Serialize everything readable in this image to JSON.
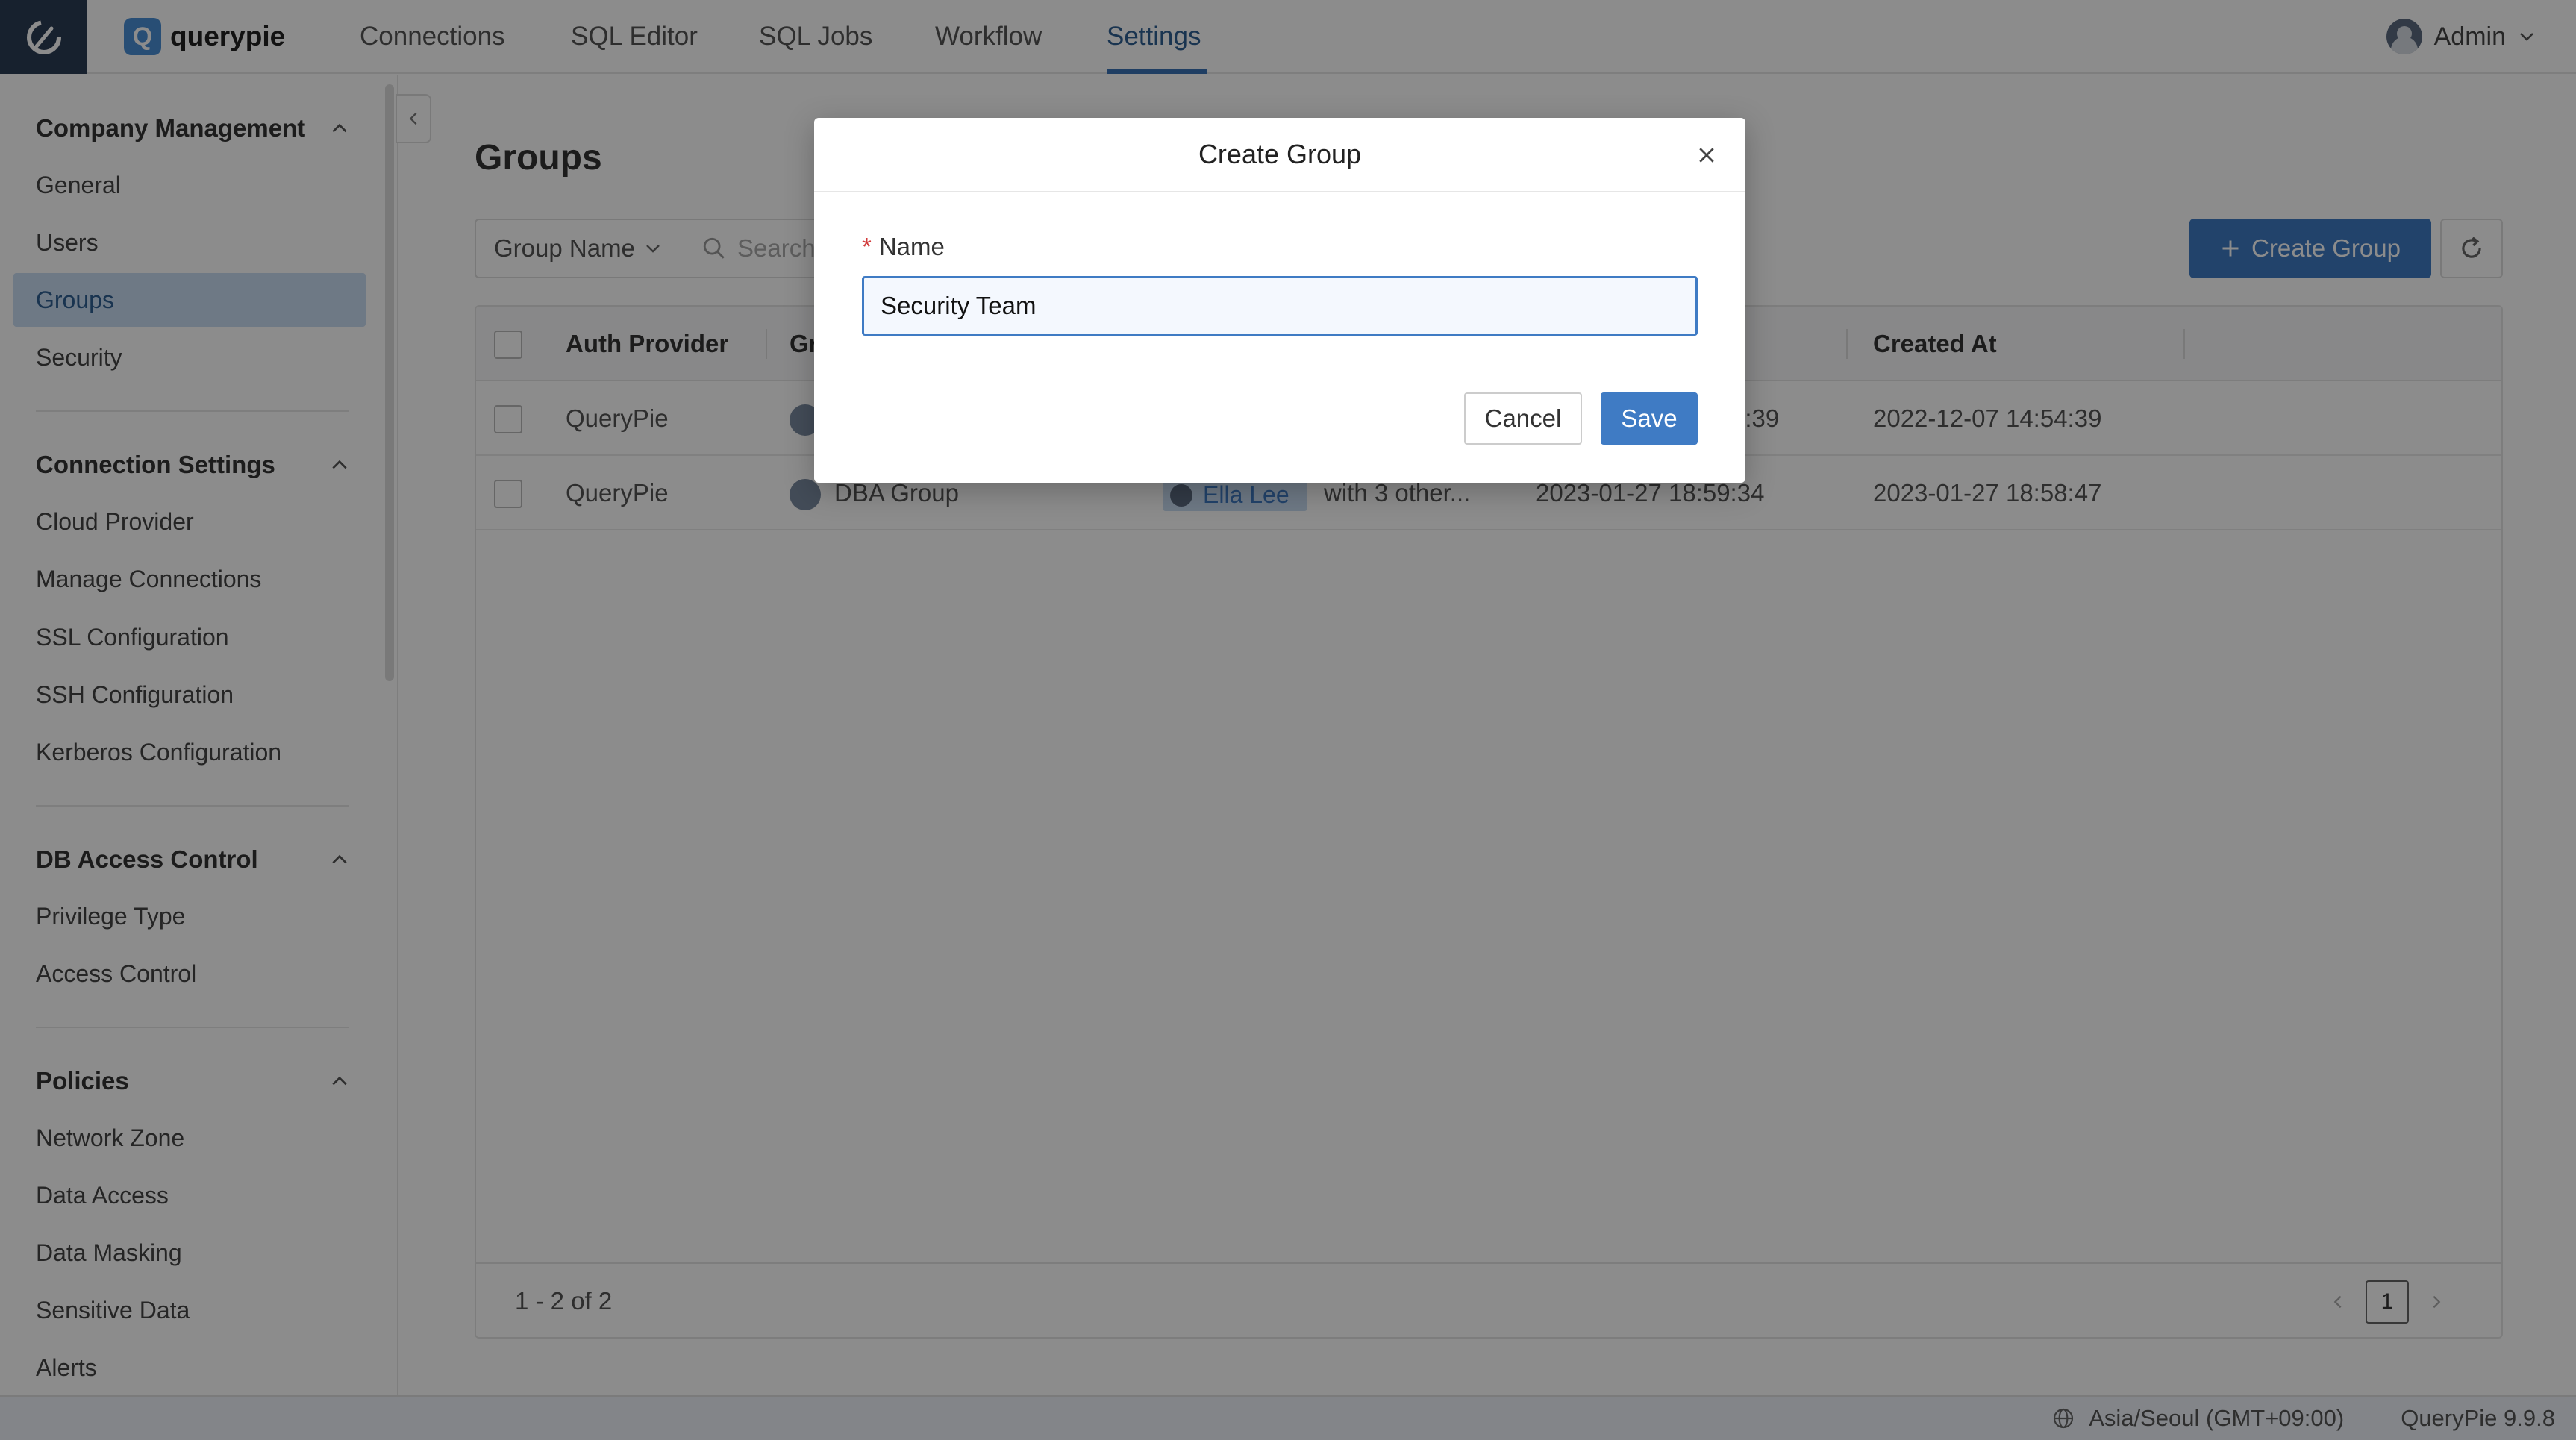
{
  "topnav": {
    "brand_name": "querypie",
    "brand_letter": "Q",
    "tabs": [
      {
        "label": "Connections"
      },
      {
        "label": "SQL Editor"
      },
      {
        "label": "SQL Jobs"
      },
      {
        "label": "Workflow"
      },
      {
        "label": "Settings",
        "active": true
      }
    ],
    "user_name": "Admin"
  },
  "sidebar": {
    "sections": [
      {
        "title": "Company Management",
        "items": [
          "General",
          "Users",
          "Groups",
          "Security"
        ]
      },
      {
        "title": "Connection Settings",
        "items": [
          "Cloud Provider",
          "Manage Connections",
          "SSL Configuration",
          "SSH Configuration",
          "Kerberos Configuration"
        ]
      },
      {
        "title": "DB Access Control",
        "items": [
          "Privilege Type",
          "Access Control"
        ]
      },
      {
        "title": "Policies",
        "items": [
          "Network Zone",
          "Data Access",
          "Data Masking",
          "Sensitive Data",
          "Alerts"
        ]
      }
    ],
    "active_item": "Groups"
  },
  "main": {
    "title": "Groups",
    "filter_field": "Group Name",
    "search_placeholder": "Search",
    "create_button": "Create Group",
    "table": {
      "columns": [
        "Auth Provider",
        "Gr",
        "Created At"
      ],
      "rows": [
        {
          "auth_provider": "QueryPie",
          "group_name": "",
          "member": "",
          "members_more": "",
          "updated_at": "4:39",
          "created_at": "2022-12-07 14:54:39"
        },
        {
          "auth_provider": "QueryPie",
          "group_name": "DBA Group",
          "member": "Ella Lee",
          "members_more": "with 3 other...",
          "updated_at": "2023-01-27 18:59:34",
          "created_at": "2023-01-27 18:58:47"
        }
      ]
    },
    "pagination": {
      "summary": "1 - 2 of 2",
      "current_page": "1"
    }
  },
  "statusbar": {
    "timezone": "Asia/Seoul (GMT+09:00)",
    "version": "QueryPie 9.9.8"
  },
  "modal": {
    "title": "Create Group",
    "name_label": "Name",
    "required_mark": "*",
    "name_value": "Security Team",
    "cancel_label": "Cancel",
    "save_label": "Save"
  },
  "colors": {
    "accent": "#3f7bc4",
    "nav_dark": "#2b3c55",
    "active_bg": "#c9dcf2",
    "required": "#d23b3b"
  }
}
